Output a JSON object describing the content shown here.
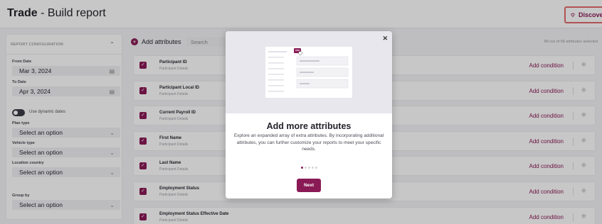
{
  "header": {
    "title_bold": "Trade",
    "title_rest": " - Build report",
    "discover_label": "Discover",
    "discover_icon": "bulb-icon"
  },
  "sidebar": {
    "section_title": "REPORT CONFIGURATION",
    "from_date_label": "From Date",
    "from_date_value": "Mar 3, 2024",
    "to_date_label": "To Date",
    "to_date_value": "Apr 3, 2024",
    "dynamic_dates_label": "Use dynamic dates",
    "plan_type_label": "Plan type",
    "plan_type_value": "Select an option",
    "vehicle_type_label": "Vehicle type",
    "vehicle_type_value": "Select an option",
    "location_country_label": "Location country",
    "location_country_value": "Select an option",
    "group_by_label": "Group by",
    "group_by_value": "Select an option"
  },
  "main": {
    "add_attributes_label": "Add attributes",
    "search_placeholder": "Search",
    "selected_count": "88 out of 68 attributes selected",
    "add_condition_label": "Add condition",
    "attributes": [
      {
        "name": "Participant ID",
        "category": "Participant Details"
      },
      {
        "name": "Participant Local ID",
        "category": "Participant Details"
      },
      {
        "name": "Current Payroll ID",
        "category": "Participant Details"
      },
      {
        "name": "First Name",
        "category": "Participant Details"
      },
      {
        "name": "Last Name",
        "category": "Participant Details"
      },
      {
        "name": "Employment Status",
        "category": "Participant Details"
      },
      {
        "name": "Employment Status Effective Date",
        "category": "Participant Details"
      }
    ]
  },
  "modal": {
    "title": "Add more attributes",
    "body": "Explore an expanded array of extra attributes. By incorporating additional attributes, you can further customize your reports to meet your specific needs.",
    "next_label": "Next",
    "pages": 5,
    "current_page": 1
  },
  "colors": {
    "accent": "#8a1a55",
    "highlight_border": "#e36b6b"
  }
}
